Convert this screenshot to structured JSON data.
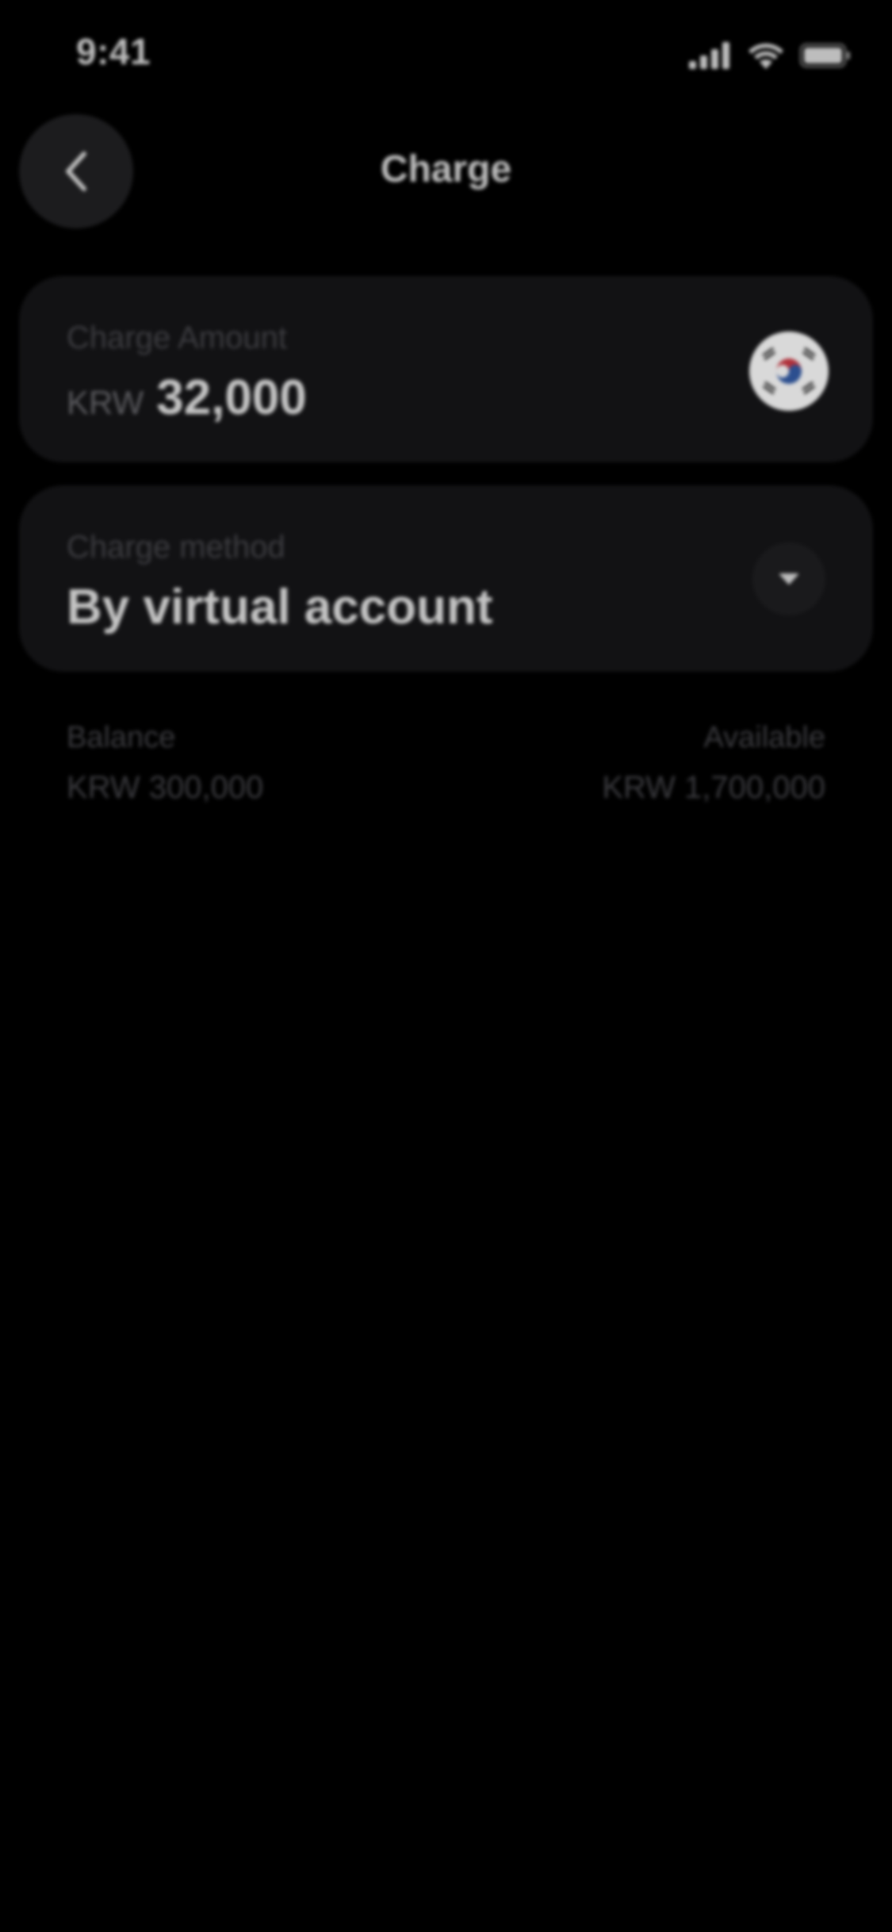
{
  "status_bar": {
    "time": "9:41",
    "icons": [
      "signal-icon",
      "wifi-icon",
      "battery-icon"
    ]
  },
  "header": {
    "title": "Charge",
    "back_icon": "chevron-left-icon"
  },
  "charge_amount": {
    "label": "Charge Amount",
    "currency": "KRW",
    "value": "32,000",
    "flag_icon": "south-korea-flag-icon"
  },
  "charge_method": {
    "label": "Charge method",
    "value": "By virtual account",
    "dropdown_icon": "caret-down-icon"
  },
  "balance": {
    "label": "Balance",
    "value": "KRW 300,000"
  },
  "available": {
    "label": "Available",
    "value": "KRW 1,700,000"
  },
  "colors": {
    "background": "#000000",
    "card": "#121214",
    "button": "#1c1c1e"
  }
}
